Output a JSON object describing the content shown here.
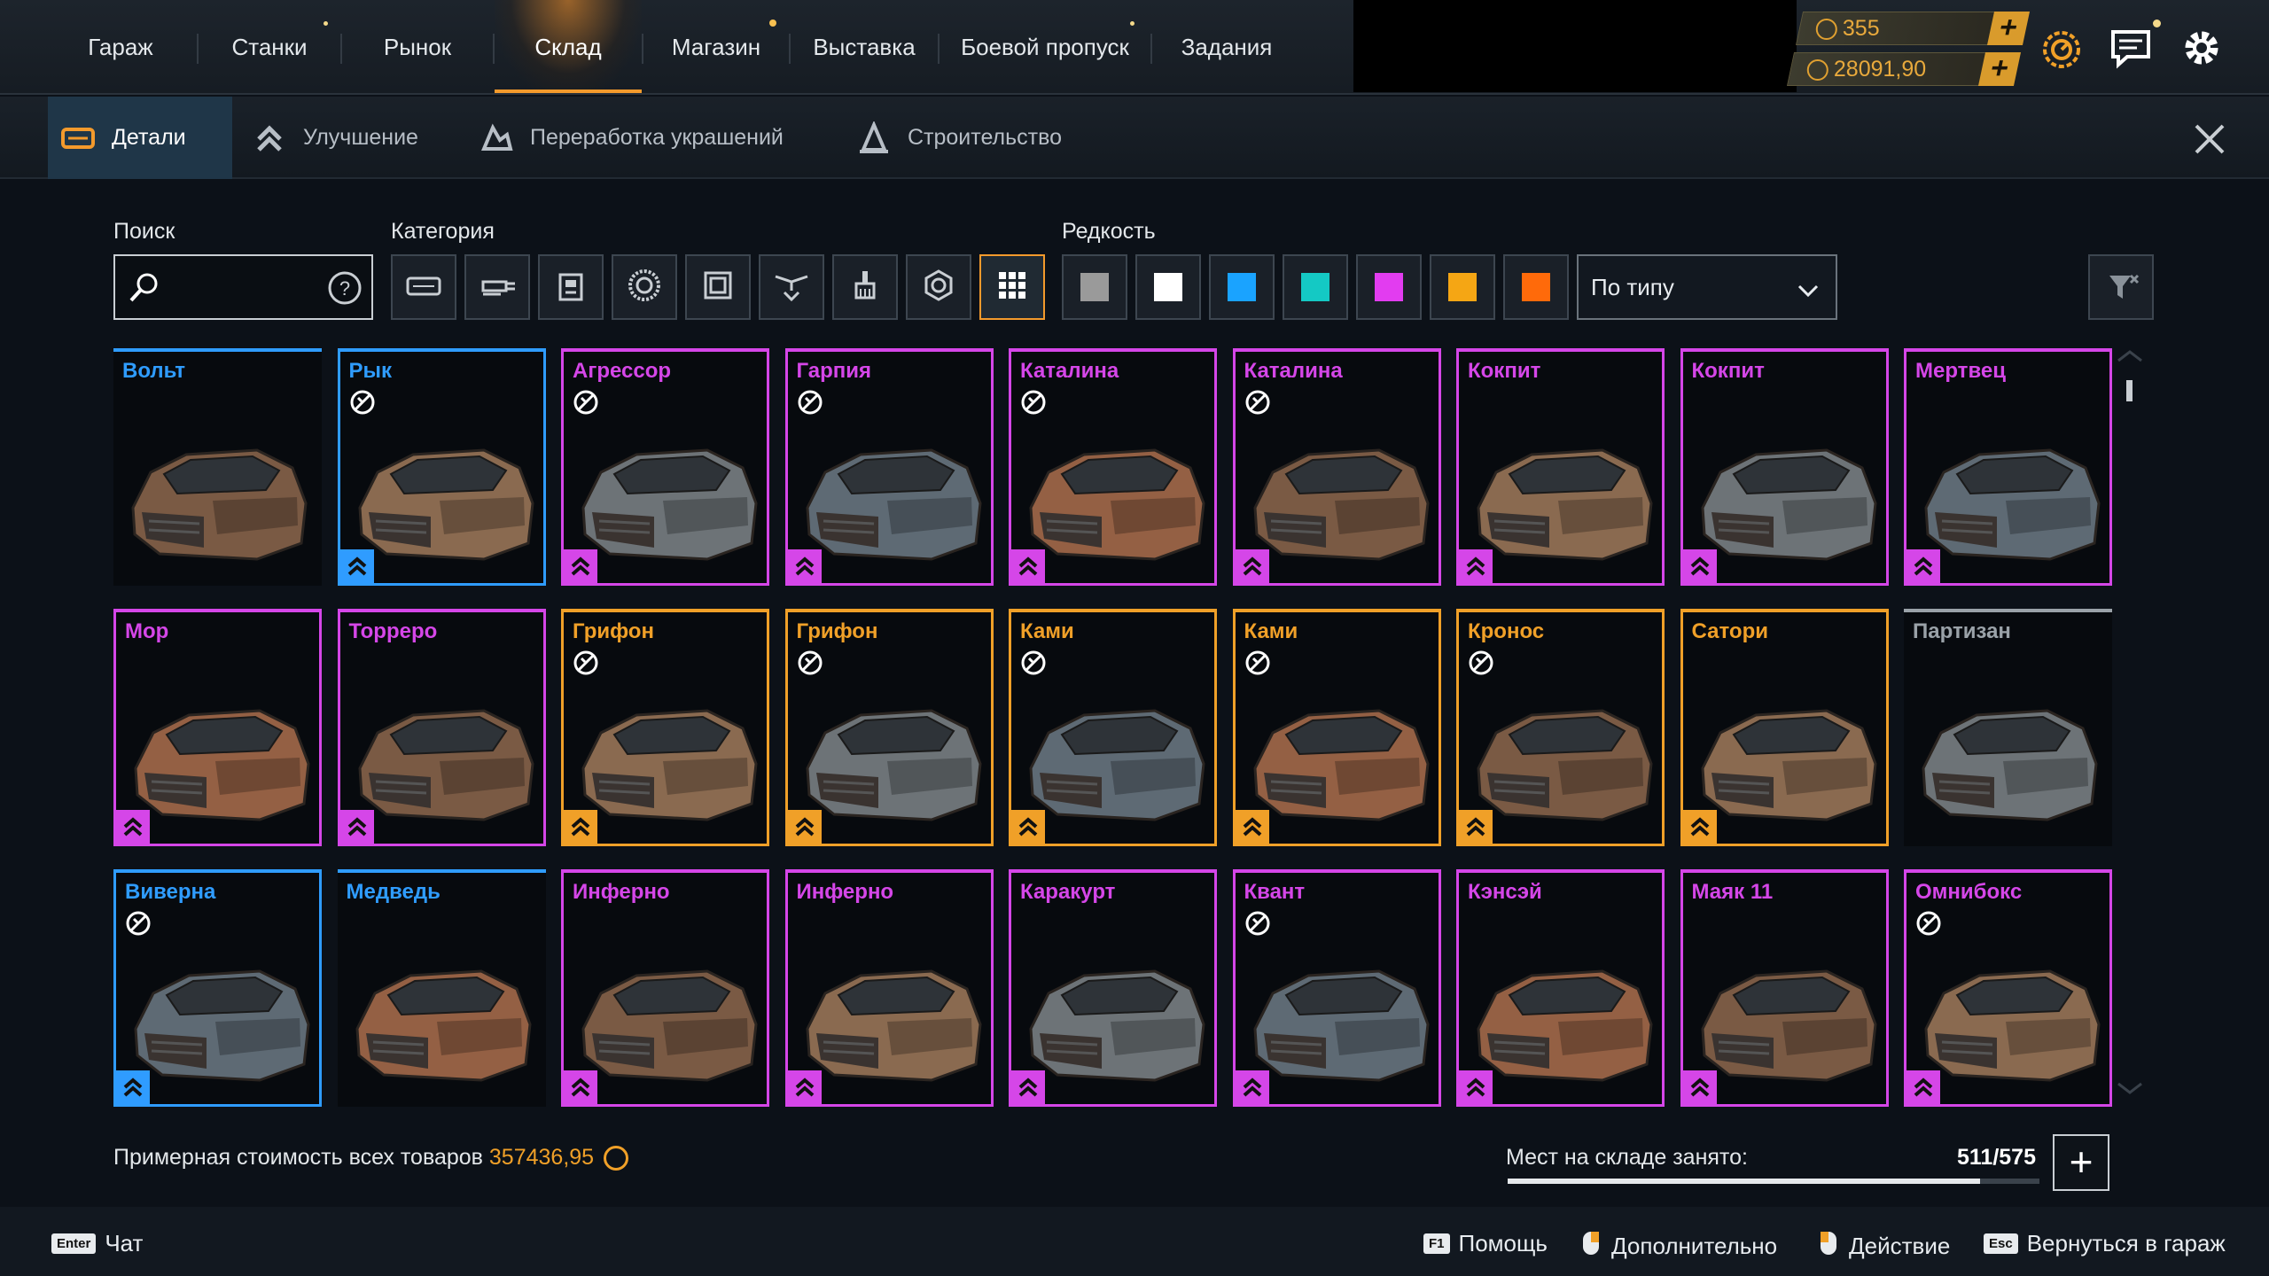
{
  "nav": {
    "tabs": [
      {
        "label": "Гараж"
      },
      {
        "label": "Станки"
      },
      {
        "label": "Рынок"
      },
      {
        "label": "Склад"
      },
      {
        "label": "Магазин"
      },
      {
        "label": "Выставка"
      },
      {
        "label": "Боевой пропуск"
      },
      {
        "label": "Задания"
      }
    ],
    "active_tab": "Склад"
  },
  "currency": {
    "coins": "355",
    "credits": "28091,90"
  },
  "subtabs": [
    {
      "label": "Детали"
    },
    {
      "label": "Улучшение"
    },
    {
      "label": "Переработка украшений"
    },
    {
      "label": "Строительство"
    }
  ],
  "filters": {
    "search_label": "Поиск",
    "category_label": "Категория",
    "rarity_label": "Редкость",
    "search_value": "",
    "sort_value": "По типу",
    "category_icons": [
      "cabin-icon",
      "weapon-icon",
      "module-icon",
      "wheel-icon",
      "frame-icon",
      "decor-icon",
      "paint-icon",
      "engine-icon",
      "all-grid-icon"
    ],
    "rarity_colors": [
      "#9a9a9a",
      "#ffffff",
      "#1aa3ff",
      "#14c9c4",
      "#e23cf0",
      "#f5a614",
      "#ff6a0a"
    ]
  },
  "colors": {
    "blue": "#2f9cff",
    "purple": "#d546e8",
    "orange": "#f0a028",
    "gray": "#9aa2a8",
    "accent": "#f39a2c"
  },
  "items": [
    {
      "name": "Вольт",
      "rarity": "blue",
      "nocraft": false,
      "upgrade": false
    },
    {
      "name": "Рык",
      "rarity": "blue",
      "nocraft": true,
      "upgrade": true
    },
    {
      "name": "Агрессор",
      "rarity": "purple",
      "nocraft": true,
      "upgrade": true
    },
    {
      "name": "Гарпия",
      "rarity": "purple",
      "nocraft": true,
      "upgrade": true
    },
    {
      "name": "Каталина",
      "rarity": "purple",
      "nocraft": true,
      "upgrade": true
    },
    {
      "name": "Каталина",
      "rarity": "purple",
      "nocraft": true,
      "upgrade": true
    },
    {
      "name": "Кокпит",
      "rarity": "purple",
      "nocraft": false,
      "upgrade": true
    },
    {
      "name": "Кокпит",
      "rarity": "purple",
      "nocraft": false,
      "upgrade": true
    },
    {
      "name": "Мертвец",
      "rarity": "purple",
      "nocraft": false,
      "upgrade": true
    },
    {
      "name": "Мор",
      "rarity": "purple",
      "nocraft": false,
      "upgrade": true
    },
    {
      "name": "Торреро",
      "rarity": "purple",
      "nocraft": false,
      "upgrade": true
    },
    {
      "name": "Грифон",
      "rarity": "orange",
      "nocraft": true,
      "upgrade": true
    },
    {
      "name": "Грифон",
      "rarity": "orange",
      "nocraft": true,
      "upgrade": true
    },
    {
      "name": "Ками",
      "rarity": "orange",
      "nocraft": true,
      "upgrade": true
    },
    {
      "name": "Ками",
      "rarity": "orange",
      "nocraft": true,
      "upgrade": true
    },
    {
      "name": "Кронос",
      "rarity": "orange",
      "nocraft": true,
      "upgrade": true
    },
    {
      "name": "Сатори",
      "rarity": "orange",
      "nocraft": false,
      "upgrade": true
    },
    {
      "name": "Партизан",
      "rarity": "gray",
      "nocraft": false,
      "upgrade": false
    },
    {
      "name": "Виверна",
      "rarity": "blue",
      "nocraft": true,
      "upgrade": true
    },
    {
      "name": "Медведь",
      "rarity": "blue",
      "nocraft": false,
      "upgrade": false
    },
    {
      "name": "Инферно",
      "rarity": "purple",
      "nocraft": false,
      "upgrade": true
    },
    {
      "name": "Инферно",
      "rarity": "purple",
      "nocraft": false,
      "upgrade": true
    },
    {
      "name": "Каракурт",
      "rarity": "purple",
      "nocraft": false,
      "upgrade": true
    },
    {
      "name": "Квант",
      "rarity": "purple",
      "nocraft": true,
      "upgrade": true
    },
    {
      "name": "Кэнсэй",
      "rarity": "purple",
      "nocraft": false,
      "upgrade": true
    },
    {
      "name": "Маяк 11",
      "rarity": "purple",
      "nocraft": false,
      "upgrade": true
    },
    {
      "name": "Омнибокс",
      "rarity": "purple",
      "nocraft": true,
      "upgrade": true
    }
  ],
  "footer": {
    "total_label": "Примерная стоимость всех товаров",
    "total_value": "357436,95",
    "storage_label": "Мест на складе занято:",
    "storage_value": "511/575",
    "storage_fraction": 0.889
  },
  "bottom_hints": [
    {
      "key": "Enter",
      "label": "Чат"
    },
    {
      "key": "F1",
      "label": "Помощь"
    },
    {
      "key": "",
      "label": "Дополнительно"
    },
    {
      "key": "",
      "label": "Действие"
    },
    {
      "key": "Esc",
      "label": "Вернуться в гараж"
    }
  ]
}
